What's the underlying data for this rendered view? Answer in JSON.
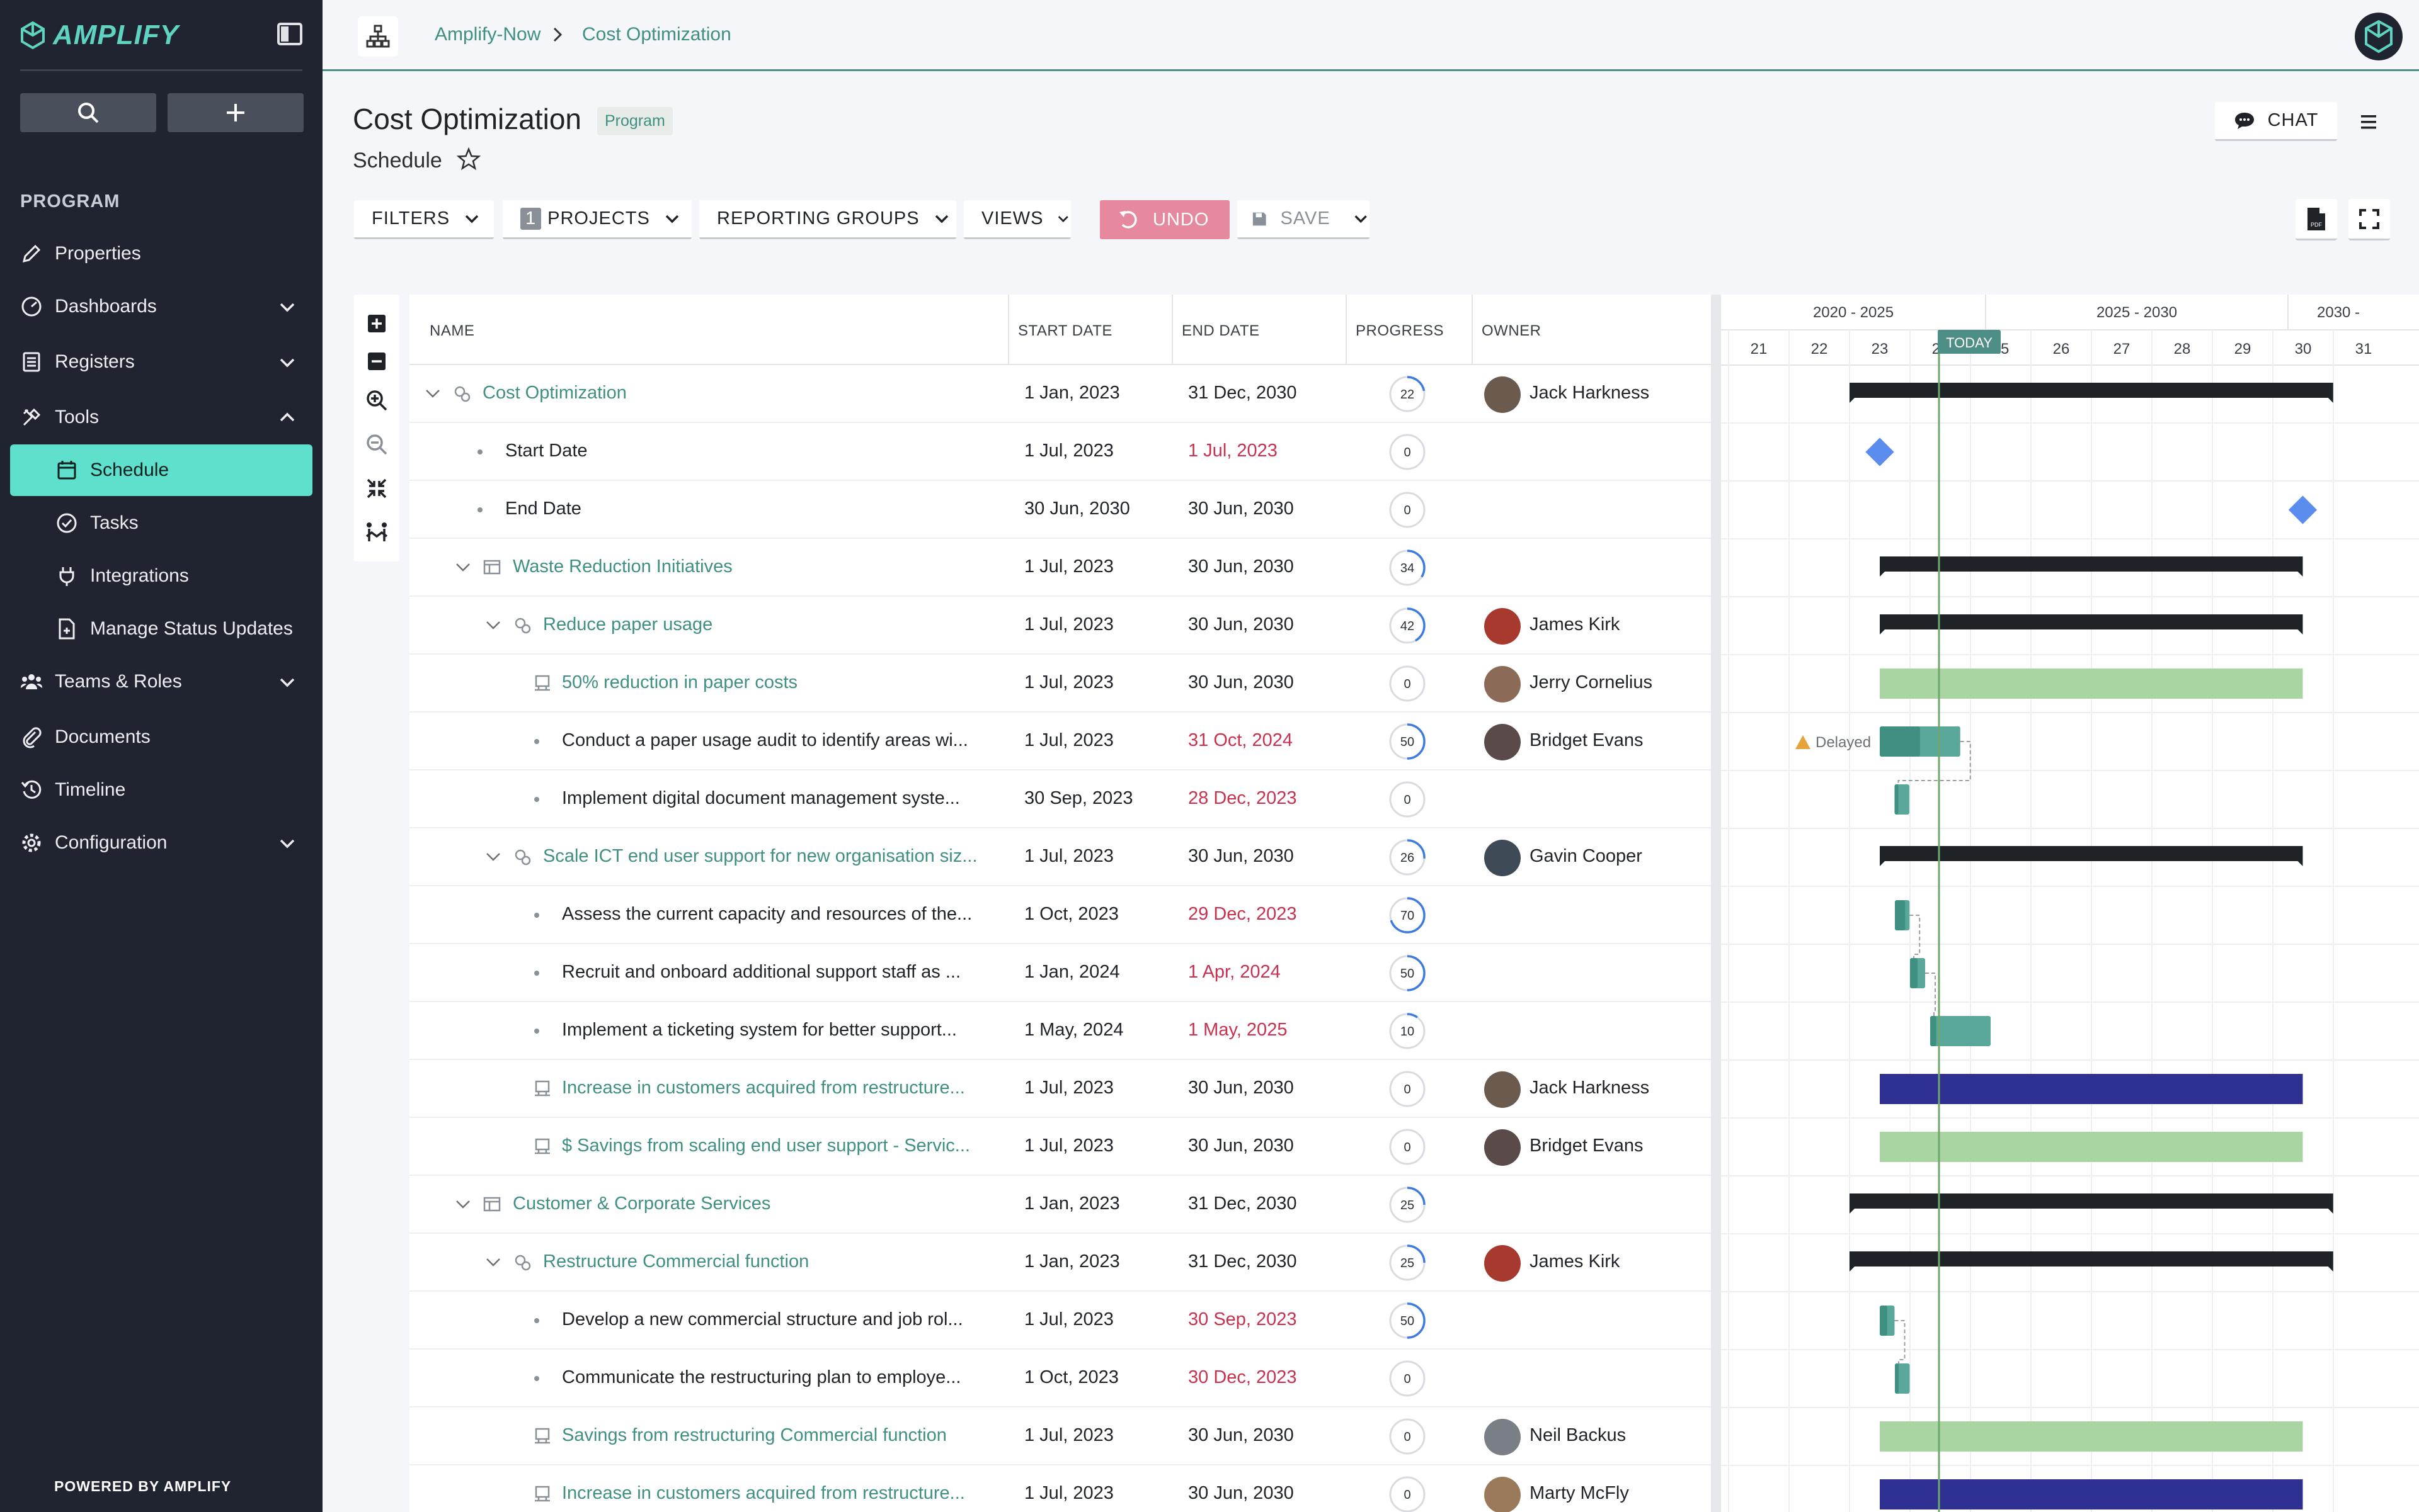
{
  "app": {
    "name": "AMPLIFY",
    "powered_by": "POWERED BY",
    "powered_brand": "AMPLIFY"
  },
  "sidebar": {
    "section": "PROGRAM",
    "items": [
      {
        "label": "Properties",
        "icon": "pencil-icon"
      },
      {
        "label": "Dashboards",
        "icon": "dashboard-icon",
        "chevron": "down"
      },
      {
        "label": "Registers",
        "icon": "register-icon",
        "chevron": "down"
      },
      {
        "label": "Tools",
        "icon": "tools-icon",
        "chevron": "up"
      },
      {
        "label": "Schedule",
        "icon": "calendar-icon",
        "active": true
      },
      {
        "label": "Tasks",
        "icon": "check-circle-icon"
      },
      {
        "label": "Integrations",
        "icon": "plug-icon"
      },
      {
        "label": "Manage Status Updates",
        "icon": "status-doc-icon"
      },
      {
        "label": "Teams & Roles",
        "icon": "team-icon",
        "chevron": "down"
      },
      {
        "label": "Documents",
        "icon": "paperclip-icon"
      },
      {
        "label": "Timeline",
        "icon": "history-icon"
      },
      {
        "label": "Configuration",
        "icon": "gear-icon",
        "chevron": "down"
      }
    ]
  },
  "breadcrumb": {
    "root": "Amplify-Now",
    "current": "Cost Optimization"
  },
  "header": {
    "title": "Cost Optimization",
    "badge": "Program",
    "subtitle": "Schedule",
    "chat": "CHAT"
  },
  "toolbar": {
    "filters": "FILTERS",
    "projects_count": "1",
    "projects": "PROJECTS",
    "reporting_groups": "REPORTING GROUPS",
    "views": "VIEWS",
    "undo": "UNDO",
    "save": "SAVE"
  },
  "table": {
    "headers": {
      "name": "NAME",
      "start": "START DATE",
      "end": "END DATE",
      "progress": "PROGRESS",
      "owner": "OWNER"
    },
    "rows": [
      {
        "name": "Cost Optimization",
        "start": "1 Jan, 2023",
        "end": "31 Dec, 2030",
        "progress": 22,
        "owner": "Jack Harkness",
        "level": 1,
        "kind": "program",
        "link": true,
        "end_red": false
      },
      {
        "name": "Start Date",
        "start": "1 Jul, 2023",
        "end": "1 Jul, 2023",
        "progress": 0,
        "owner": "",
        "level": 2,
        "kind": "milestone",
        "link": false,
        "end_red": true
      },
      {
        "name": "End Date",
        "start": "30 Jun, 2030",
        "end": "30 Jun, 2030",
        "progress": 0,
        "owner": "",
        "level": 2,
        "kind": "milestone",
        "link": false,
        "end_red": false
      },
      {
        "name": "Waste Reduction Initiatives",
        "start": "1 Jul, 2023",
        "end": "30 Jun, 2030",
        "progress": 34,
        "owner": "",
        "level": 2,
        "kind": "group",
        "link": true,
        "end_red": false
      },
      {
        "name": "Reduce paper usage",
        "start": "1 Jul, 2023",
        "end": "30 Jun, 2030",
        "progress": 42,
        "owner": "James Kirk",
        "level": 3,
        "kind": "project",
        "link": true,
        "end_red": false
      },
      {
        "name": "50% reduction in paper costs",
        "start": "1 Jul, 2023",
        "end": "30 Jun, 2030",
        "progress": 0,
        "owner": "Jerry Cornelius",
        "level": 4,
        "kind": "benefit",
        "link": true,
        "end_red": false
      },
      {
        "name": "Conduct a paper usage audit to identify areas wi...",
        "start": "1 Jul, 2023",
        "end": "31 Oct, 2024",
        "progress": 50,
        "owner": "Bridget Evans",
        "level": 4,
        "kind": "task",
        "link": false,
        "end_red": true
      },
      {
        "name": "Implement digital document management syste...",
        "start": "30 Sep, 2023",
        "end": "28 Dec, 2023",
        "progress": 0,
        "owner": "",
        "level": 4,
        "kind": "task",
        "link": false,
        "end_red": true
      },
      {
        "name": "Scale ICT end user support for new organisation siz...",
        "start": "1 Jul, 2023",
        "end": "30 Jun, 2030",
        "progress": 26,
        "owner": "Gavin Cooper",
        "level": 3,
        "kind": "project",
        "link": true,
        "end_red": false
      },
      {
        "name": "Assess the current capacity and resources of the...",
        "start": "1 Oct, 2023",
        "end": "29 Dec, 2023",
        "progress": 70,
        "owner": "",
        "level": 4,
        "kind": "task",
        "link": false,
        "end_red": true
      },
      {
        "name": "Recruit and onboard additional support staff as ...",
        "start": "1 Jan, 2024",
        "end": "1 Apr, 2024",
        "progress": 50,
        "owner": "",
        "level": 4,
        "kind": "task",
        "link": false,
        "end_red": true
      },
      {
        "name": "Implement a ticketing system for better support...",
        "start": "1 May, 2024",
        "end": "1 May, 2025",
        "progress": 10,
        "owner": "",
        "level": 4,
        "kind": "task",
        "link": false,
        "end_red": true
      },
      {
        "name": "Increase in customers acquired from restructure...",
        "start": "1 Jul, 2023",
        "end": "30 Jun, 2030",
        "progress": 0,
        "owner": "Jack Harkness",
        "level": 4,
        "kind": "benefit",
        "link": true,
        "end_red": false
      },
      {
        "name": "$ Savings from scaling end user support - Servic...",
        "start": "1 Jul, 2023",
        "end": "30 Jun, 2030",
        "progress": 0,
        "owner": "Bridget Evans",
        "level": 4,
        "kind": "benefit",
        "link": true,
        "end_red": false
      },
      {
        "name": "Customer & Corporate Services",
        "start": "1 Jan, 2023",
        "end": "31 Dec, 2030",
        "progress": 25,
        "owner": "",
        "level": 2,
        "kind": "group",
        "link": true,
        "end_red": false
      },
      {
        "name": "Restructure Commercial function",
        "start": "1 Jan, 2023",
        "end": "31 Dec, 2030",
        "progress": 25,
        "owner": "James Kirk",
        "level": 3,
        "kind": "project",
        "link": true,
        "end_red": false
      },
      {
        "name": "Develop a new commercial structure and job rol...",
        "start": "1 Jul, 2023",
        "end": "30 Sep, 2023",
        "progress": 50,
        "owner": "",
        "level": 4,
        "kind": "task",
        "link": false,
        "end_red": true
      },
      {
        "name": "Communicate the restructuring plan to employe...",
        "start": "1 Oct, 2023",
        "end": "30 Dec, 2023",
        "progress": 0,
        "owner": "",
        "level": 4,
        "kind": "task",
        "link": false,
        "end_red": true
      },
      {
        "name": "Savings from restructuring Commercial function",
        "start": "1 Jul, 2023",
        "end": "30 Jun, 2030",
        "progress": 0,
        "owner": "Neil Backus",
        "level": 4,
        "kind": "benefit",
        "link": true,
        "end_red": false
      },
      {
        "name": "Increase in customers acquired from restructure...",
        "start": "1 Jul, 2023",
        "end": "30 Jun, 2030",
        "progress": 0,
        "owner": "Marty McFly",
        "level": 4,
        "kind": "benefit",
        "link": true,
        "end_red": false
      }
    ]
  },
  "gantt": {
    "periods": [
      "2020 - 2025",
      "2025 - 2030",
      "2030 -"
    ],
    "years": [
      "21",
      "22",
      "23",
      "24",
      "25",
      "26",
      "27",
      "28",
      "29",
      "30",
      "31"
    ],
    "today_label": "TODAY",
    "delayed_label": "Delayed",
    "colors": {
      "summary": "#1f2328",
      "benefit_green": "#a8d5a2",
      "benefit_navy": "#2e3192",
      "task": "#5aa89b",
      "milestone": "#5b8def",
      "today": "#6ea86a",
      "delayed": "#e6a23c"
    }
  }
}
